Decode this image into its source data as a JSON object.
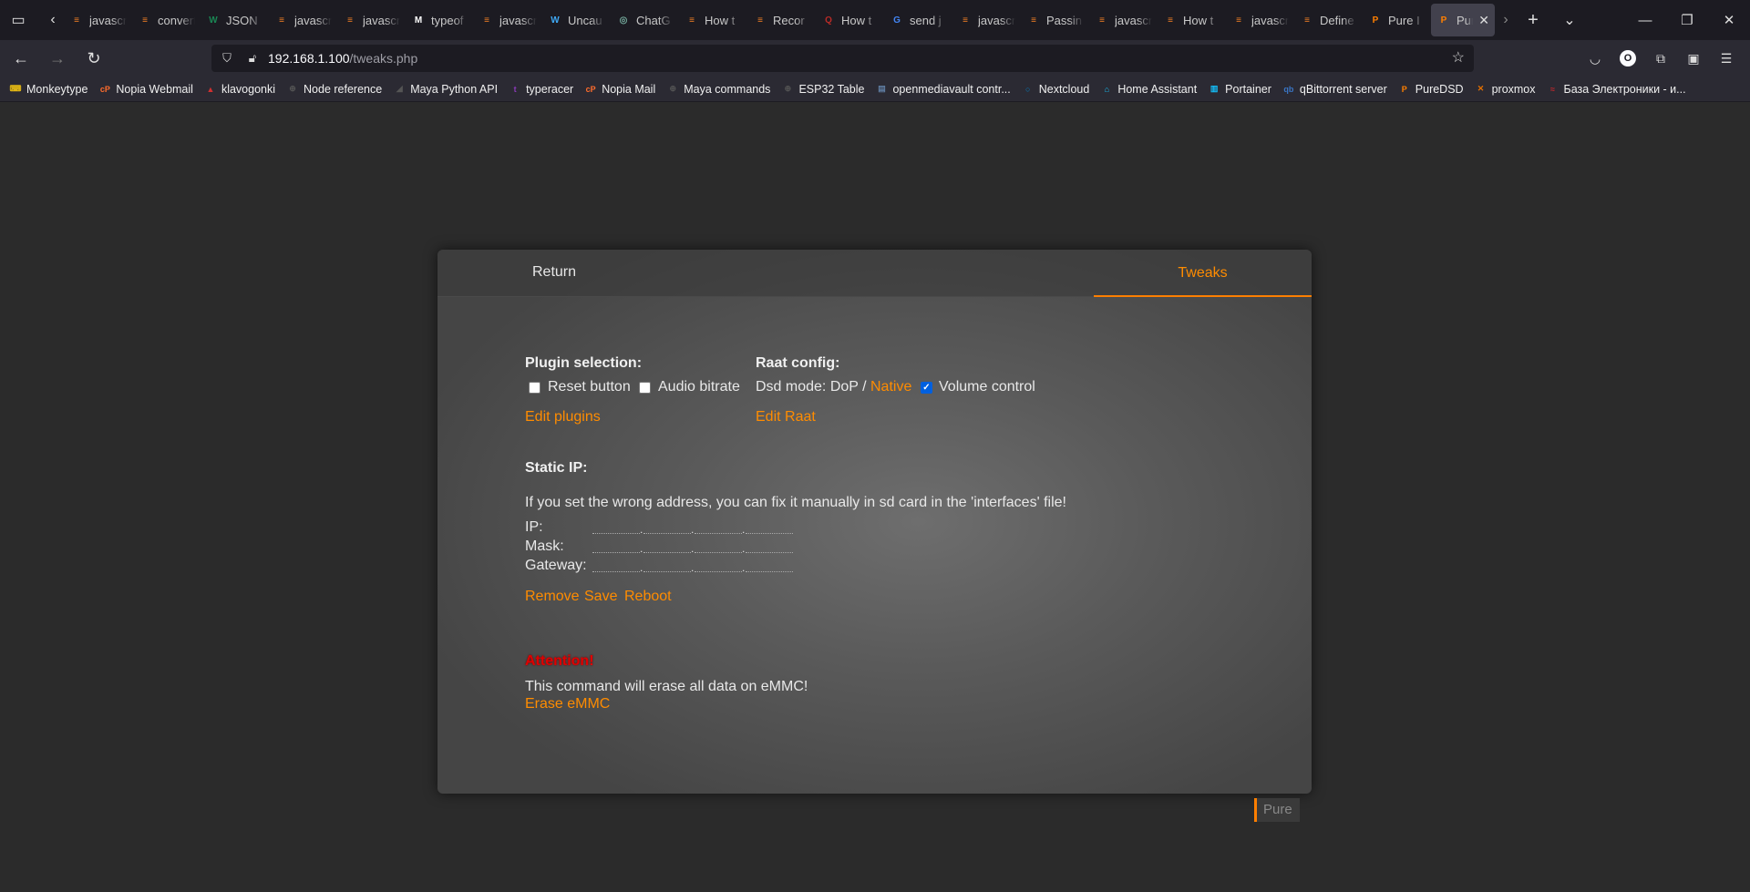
{
  "tabs": [
    {
      "title": "javascr",
      "color": "#f48024",
      "glyph": "≡"
    },
    {
      "title": "convert",
      "color": "#f48024",
      "glyph": "≡"
    },
    {
      "title": "JSON",
      "color": "#1a8754",
      "glyph": "W"
    },
    {
      "title": "javascr",
      "color": "#f48024",
      "glyph": "≡"
    },
    {
      "title": "javascr",
      "color": "#f48024",
      "glyph": "≡"
    },
    {
      "title": "typeof",
      "color": "#ffffff",
      "glyph": "M"
    },
    {
      "title": "javascr",
      "color": "#f48024",
      "glyph": "≡"
    },
    {
      "title": "Uncau",
      "color": "#3fa9f5",
      "glyph": "W"
    },
    {
      "title": "ChatG",
      "color": "#74aa9c",
      "glyph": "◎"
    },
    {
      "title": "How t",
      "color": "#f48024",
      "glyph": "≡"
    },
    {
      "title": "Recor",
      "color": "#f48024",
      "glyph": "≡"
    },
    {
      "title": "How t",
      "color": "#b92b27",
      "glyph": "Q"
    },
    {
      "title": "send j",
      "color": "#4285f4",
      "glyph": "G"
    },
    {
      "title": "javascr",
      "color": "#f48024",
      "glyph": "≡"
    },
    {
      "title": "Passin",
      "color": "#f48024",
      "glyph": "≡"
    },
    {
      "title": "javascr",
      "color": "#f48024",
      "glyph": "≡"
    },
    {
      "title": "How t",
      "color": "#f48024",
      "glyph": "≡"
    },
    {
      "title": "javascr",
      "color": "#f48024",
      "glyph": "≡"
    },
    {
      "title": "Define",
      "color": "#f48024",
      "glyph": "≡"
    },
    {
      "title": "Pure I",
      "color": "#ff7f00",
      "glyph": "P"
    },
    {
      "title": "Pur",
      "color": "#ff7f00",
      "glyph": "P",
      "active": true
    }
  ],
  "url": {
    "host": "192.168.1.100",
    "path": "/tweaks.php"
  },
  "bookmarks": [
    {
      "label": "Monkeytype",
      "color": "#e2b714",
      "glyph": "⌨"
    },
    {
      "label": "Nopia Webmail",
      "color": "#ff6c2c",
      "glyph": "cP"
    },
    {
      "label": "klavogonki",
      "color": "#d03030",
      "glyph": "▲"
    },
    {
      "label": "Node reference",
      "color": "#555555",
      "glyph": "⊕"
    },
    {
      "label": "Maya Python API",
      "color": "#555555",
      "glyph": "◢"
    },
    {
      "label": "typeracer",
      "color": "#8a3ab9",
      "glyph": "t"
    },
    {
      "label": "Nopia Mail",
      "color": "#ff6c2c",
      "glyph": "cP"
    },
    {
      "label": "Maya commands",
      "color": "#555555",
      "glyph": "⊕"
    },
    {
      "label": "ESP32 Table",
      "color": "#555555",
      "glyph": "⊕"
    },
    {
      "label": "openmediavault contr...",
      "color": "#5f7ea3",
      "glyph": "▤"
    },
    {
      "label": "Nextcloud",
      "color": "#0082c9",
      "glyph": "○"
    },
    {
      "label": "Home Assistant",
      "color": "#18bcf2",
      "glyph": "⌂"
    },
    {
      "label": "Portainer",
      "color": "#13bef9",
      "glyph": "▥"
    },
    {
      "label": "qBittorrent server",
      "color": "#3a75c4",
      "glyph": "qb"
    },
    {
      "label": "PureDSD",
      "color": "#ff7f00",
      "glyph": "P"
    },
    {
      "label": "proxmox",
      "color": "#e57000",
      "glyph": "✕"
    },
    {
      "label": "База Электроники - и...",
      "color": "#c0282d",
      "glyph": "≈"
    }
  ],
  "panel": {
    "nav_return": "Return",
    "nav_tweaks": "Tweaks",
    "plugin_title": "Plugin selection:",
    "reset_button_label": "Reset button",
    "audio_bitrate_label": "Audio bitrate",
    "reset_checked": false,
    "audio_bitrate_checked": false,
    "edit_plugins": "Edit plugins",
    "raat_title": "Raat config:",
    "dsd_mode_prefix": "Dsd mode: DoP /",
    "dsd_native": "Native",
    "volume_control_label": "Volume control",
    "volume_control_checked": true,
    "edit_raat": "Edit Raat",
    "static_ip_title": "Static IP:",
    "static_ip_note": "If you set the wrong address, you can fix it manually in sd card in the 'interfaces' file!",
    "ip_label": "IP:",
    "mask_label": "Mask:",
    "gateway_label": "Gateway:",
    "remove": "Remove",
    "save": "Save",
    "reboot": "Reboot",
    "attention": "Attention!",
    "erase_warning": "This command will erase all data on eMMC!",
    "erase_emmc": "Erase eMMC"
  },
  "footer_badge": "Pure",
  "colors": {
    "accent": "#ff8c00",
    "warning": "#e00000",
    "page_bg": "#2b2b2b"
  }
}
